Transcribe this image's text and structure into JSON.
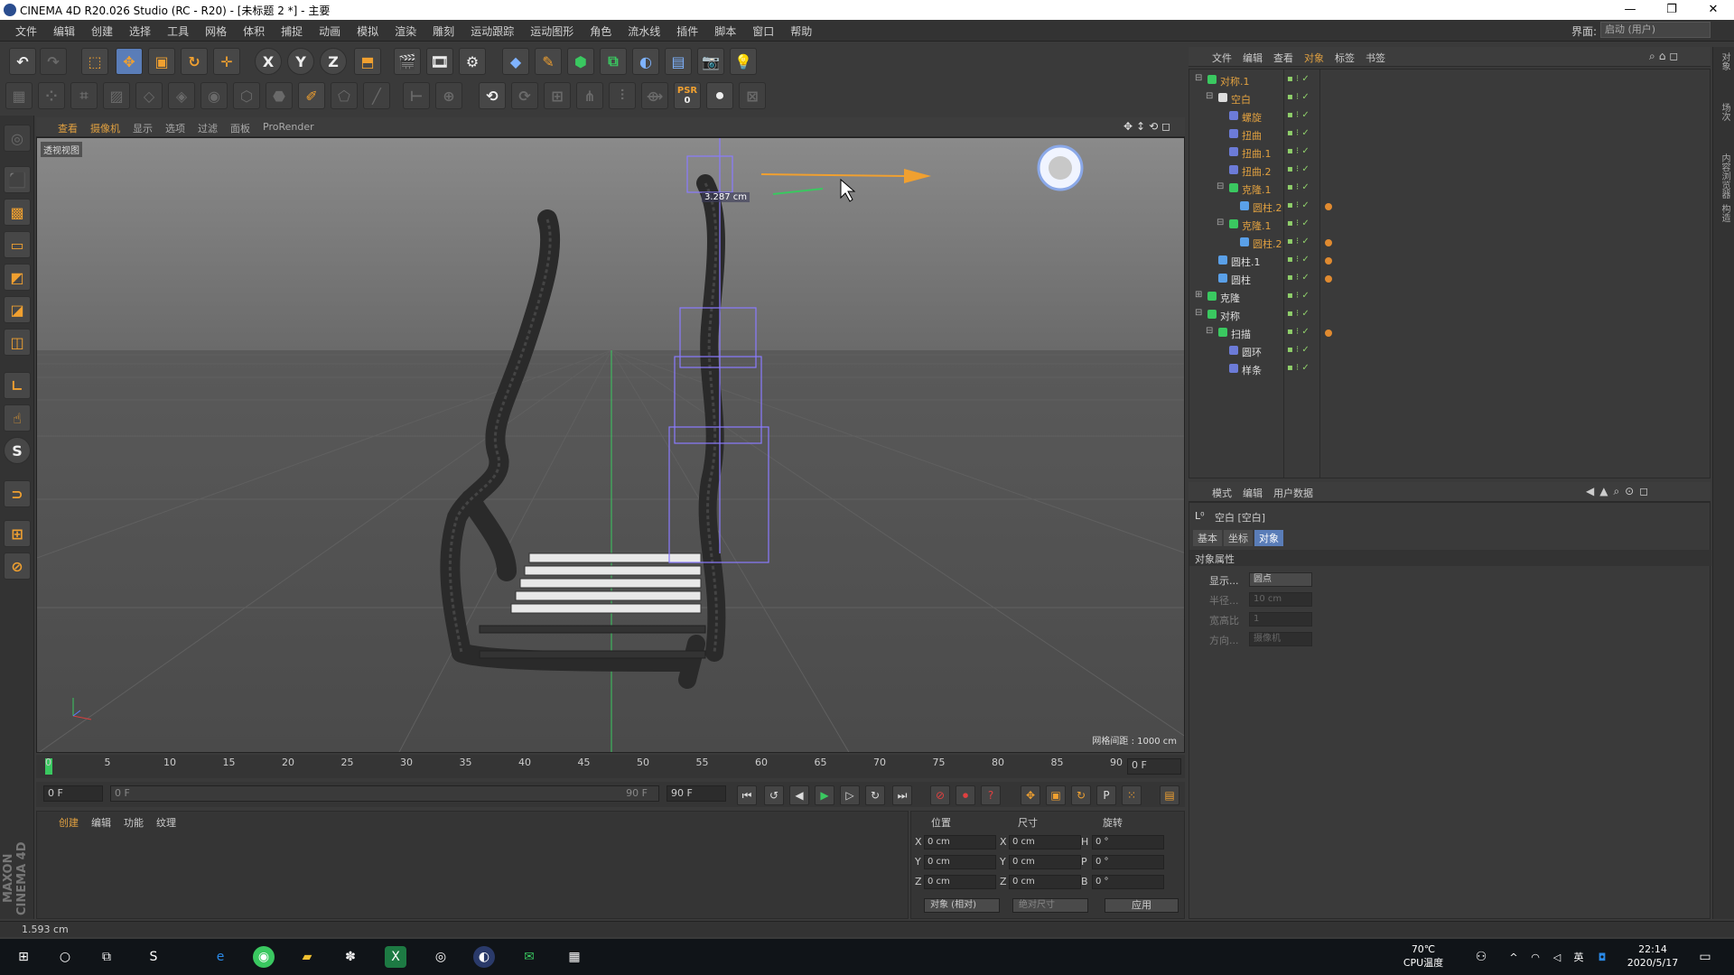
{
  "window": {
    "title": "CINEMA 4D R20.026 Studio (RC - R20) - [未标题 2 *] - 主要",
    "minimize": "—",
    "maximize": "❐",
    "close": "✕"
  },
  "menubar": {
    "items": [
      "文件",
      "编辑",
      "创建",
      "选择",
      "工具",
      "网格",
      "体积",
      "捕捉",
      "动画",
      "模拟",
      "渲染",
      "雕刻",
      "运动跟踪",
      "运动图形",
      "角色",
      "流水线",
      "插件",
      "脚本",
      "窗口",
      "帮助"
    ],
    "layout_label": "界面:",
    "layout_value": "启动 (用户)"
  },
  "toolbar": {
    "x_label": "X",
    "y_label": "Y",
    "z_label": "Z",
    "psr_label": "PSR",
    "psr_value": "0"
  },
  "viewport": {
    "tabs": [
      "查看",
      "摄像机",
      "显示",
      "选项",
      "过滤",
      "面板",
      "ProRender"
    ],
    "view_label": "透视视图",
    "grid_spacing": "网格间距 : 1000 cm",
    "measure": "3.287 cm"
  },
  "timeline": {
    "ticks": [
      "0",
      "5",
      "10",
      "15",
      "20",
      "25",
      "30",
      "35",
      "40",
      "45",
      "50",
      "55",
      "60",
      "65",
      "70",
      "75",
      "80",
      "85",
      "90"
    ],
    "current_frame": "0 F"
  },
  "transport": {
    "start": "0 F",
    "range_start": "0 F",
    "range_end": "90 F",
    "end": "90 F"
  },
  "material_panel": {
    "tabs": [
      "创建",
      "编辑",
      "功能",
      "纹理"
    ]
  },
  "coordinates": {
    "headers": [
      "位置",
      "尺寸",
      "旋转"
    ],
    "rows": [
      {
        "axis": "X",
        "pos": "0 cm",
        "size_axis": "X",
        "size": "0 cm",
        "rot_axis": "H",
        "rot": "0 °"
      },
      {
        "axis": "Y",
        "pos": "0 cm",
        "size_axis": "Y",
        "size": "0 cm",
        "rot_axis": "P",
        "rot": "0 °"
      },
      {
        "axis": "Z",
        "pos": "0 cm",
        "size_axis": "Z",
        "size": "0 cm",
        "rot_axis": "B",
        "rot": "0 °"
      }
    ],
    "mode": "对象 (相对)",
    "size_mode": "绝对尺寸",
    "apply": "应用"
  },
  "status": "1.593 cm",
  "object_manager": {
    "tabs": [
      "文件",
      "编辑",
      "查看",
      "对象",
      "标签",
      "书签"
    ],
    "objects": [
      {
        "name": "对称.1",
        "color": "orange",
        "icon": "#3ac860",
        "depth": 0,
        "exp": "⊟",
        "tag": false
      },
      {
        "name": "空白",
        "color": "orange",
        "icon": "#dddddd",
        "depth": 1,
        "exp": "⊟",
        "tag": false
      },
      {
        "name": "螺旋",
        "color": "orange",
        "icon": "#6c7bd8",
        "depth": 2,
        "exp": "",
        "tag": false
      },
      {
        "name": "扭曲",
        "color": "orange",
        "icon": "#6c7bd8",
        "depth": 2,
        "exp": "",
        "tag": false
      },
      {
        "name": "扭曲.1",
        "color": "orange",
        "icon": "#6c7bd8",
        "depth": 2,
        "exp": "",
        "tag": false
      },
      {
        "name": "扭曲.2",
        "color": "orange",
        "icon": "#6c7bd8",
        "depth": 2,
        "exp": "",
        "tag": false
      },
      {
        "name": "克隆.1",
        "color": "orange",
        "icon": "#3ac860",
        "depth": 2,
        "exp": "⊟",
        "tag": false
      },
      {
        "name": "圆柱.2",
        "color": "orange",
        "icon": "#5aa0e8",
        "depth": 3,
        "exp": "",
        "tag": true
      },
      {
        "name": "克隆.1",
        "color": "orange",
        "icon": "#3ac860",
        "depth": 2,
        "exp": "⊟",
        "tag": false
      },
      {
        "name": "圆柱.2",
        "color": "orange",
        "icon": "#5aa0e8",
        "depth": 3,
        "exp": "",
        "tag": true
      },
      {
        "name": "圆柱.1",
        "color": "white",
        "icon": "#5aa0e8",
        "depth": 1,
        "exp": "",
        "tag": true
      },
      {
        "name": "圆柱",
        "color": "white",
        "icon": "#5aa0e8",
        "depth": 1,
        "exp": "",
        "tag": true
      },
      {
        "name": "克隆",
        "color": "white",
        "icon": "#3ac860",
        "depth": 0,
        "exp": "⊞",
        "tag": false
      },
      {
        "name": "对称",
        "color": "white",
        "icon": "#3ac860",
        "depth": 0,
        "exp": "⊟",
        "tag": false
      },
      {
        "name": "扫描",
        "color": "white",
        "icon": "#3ac860",
        "depth": 1,
        "exp": "⊟",
        "tag": true
      },
      {
        "name": "圆环",
        "color": "white",
        "icon": "#6c7bd8",
        "depth": 2,
        "exp": "",
        "tag": false
      },
      {
        "name": "样条",
        "color": "white",
        "icon": "#6c7bd8",
        "depth": 2,
        "exp": "",
        "tag": false
      }
    ],
    "flags": "✓"
  },
  "attribute_manager": {
    "tabs": [
      "模式",
      "编辑",
      "用户数据"
    ],
    "object_title": "空白 [空白]",
    "attr_tabs": [
      "基本",
      "坐标",
      "对象"
    ],
    "section": "对象属性",
    "props": [
      {
        "label": "显示...",
        "value": "圆点",
        "enabled": true
      },
      {
        "label": "半径...",
        "value": "10 cm",
        "enabled": false
      },
      {
        "label": "宽高比",
        "value": "1",
        "enabled": false
      },
      {
        "label": "方向...",
        "value": "摄像机",
        "enabled": false
      }
    ]
  },
  "side_strip": [
    "对象",
    "场次",
    "内容浏览器",
    "构造"
  ],
  "taskbar": {
    "temp": "70℃",
    "temp_label": "CPU温度",
    "time": "22:14",
    "date": "2020/5/17",
    "ime": "英"
  },
  "brand": "MAXON CINEMA 4D"
}
